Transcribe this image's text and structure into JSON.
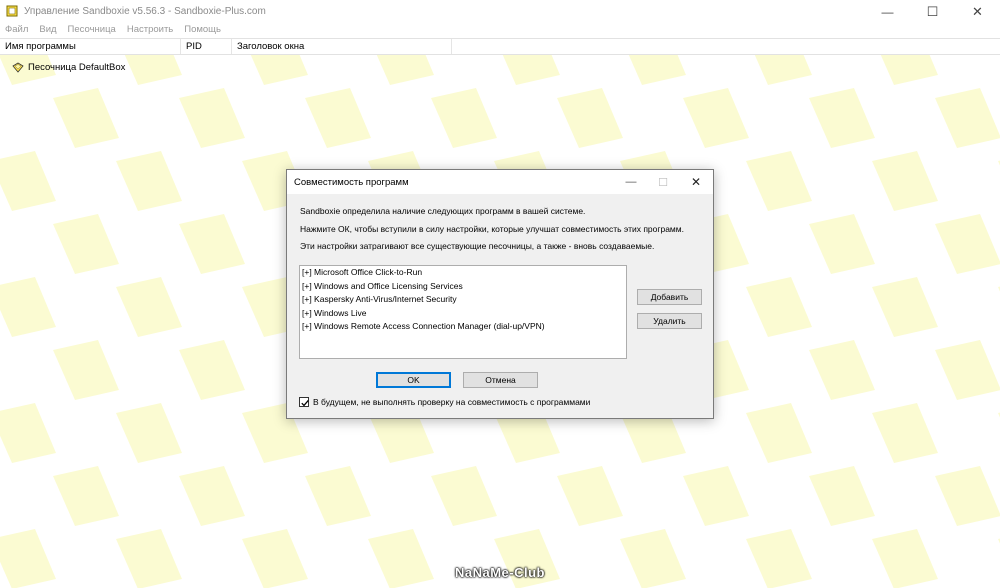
{
  "window": {
    "title": "Управление Sandboxie v5.56.3 - Sandboxie-Plus.com",
    "minimize_glyph": "—",
    "maximize_glyph": "☐",
    "close_glyph": "✕"
  },
  "menu": {
    "items": [
      "Файл",
      "Вид",
      "Песочница",
      "Настроить",
      "Помощь"
    ]
  },
  "columns": {
    "program_name": "Имя программы",
    "pid": "PID",
    "window_title": "Заголовок окна"
  },
  "tree": {
    "sandbox_label": "Песочница DefaultBox",
    "sandbox_icon": "sandbox-icon"
  },
  "dialog": {
    "title": "Совместимость программ",
    "minimize_glyph": "—",
    "maximize_glyph": "☐",
    "close_glyph": "✕",
    "line1": "Sandboxie определила наличие следующих программ в вашей системе.",
    "line2": "Нажмите ОК, чтобы вступили в силу настройки, которые улучшат совместимость этих программ.",
    "line3": "Эти настройки затрагивают все существующие песочницы, а также - вновь создаваемые.",
    "programs": [
      "[+]  Microsoft Office Click-to-Run",
      "[+]  Windows and Office Licensing Services",
      "[+]  Kaspersky Anti-Virus/Internet Security",
      "[+]  Windows Live",
      "[+]  Windows Remote Access Connection Manager (dial-up/VPN)"
    ],
    "add_label": "Добавить",
    "remove_label": "Удалить",
    "ok_label": "OK",
    "cancel_label": "Отмена",
    "checkbox_label": "В будущем, не выполнять проверку на совместимость с программами",
    "checkbox_checked": true
  },
  "watermark": "NaNaMe-Club",
  "colors": {
    "pattern_fill": "#fbfbd2",
    "accent_blue": "#0078d7",
    "dialog_bg": "#f0f0f0",
    "sandbox_yellow": "#ffe24a"
  }
}
